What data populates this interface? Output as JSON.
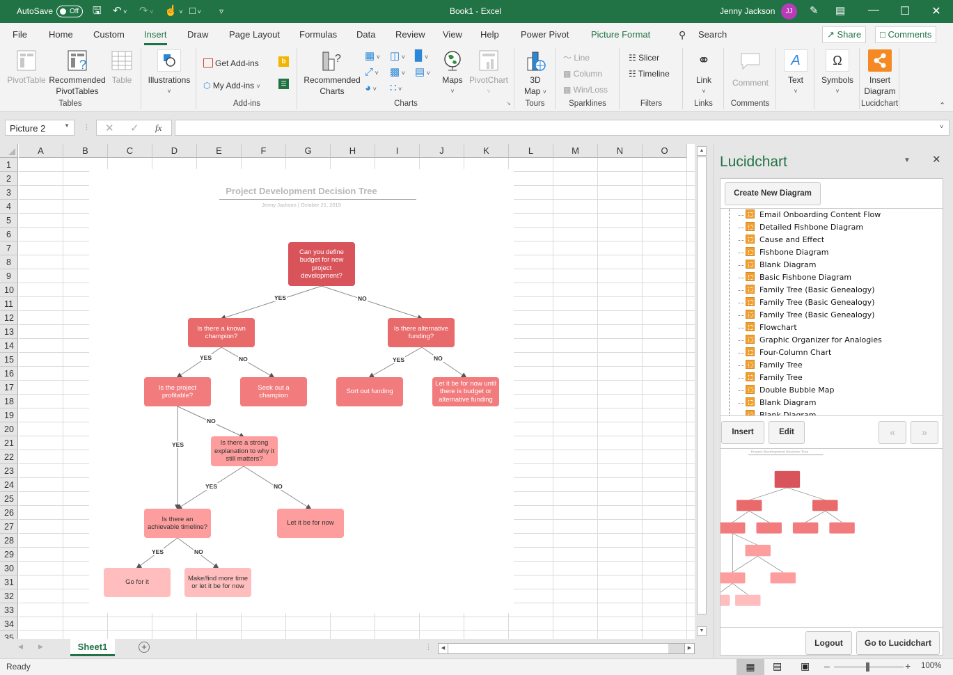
{
  "titlebar": {
    "autosave_label": "AutoSave",
    "autosave_state": "Off",
    "doc_title": "Book1  -  Excel",
    "user_name": "Jenny Jackson",
    "user_initials": "JJ"
  },
  "menu": {
    "tabs": [
      "File",
      "Home",
      "Custom",
      "Insert",
      "Draw",
      "Page Layout",
      "Formulas",
      "Data",
      "Review",
      "View",
      "Help",
      "Power Pivot",
      "Picture Format"
    ],
    "active_tab": "Insert",
    "search_label": "Search",
    "share_label": "Share",
    "comments_label": "Comments"
  },
  "ribbon": {
    "tables": {
      "label": "Tables",
      "pivottable": "PivotTable",
      "recommended_pivot": "Recommended\nPivotTables",
      "rec_l1": "Recommended",
      "rec_l2": "PivotTables",
      "table": "Table"
    },
    "illustrations": {
      "label": "Illustrations"
    },
    "addins": {
      "label": "Add-ins",
      "get": "Get Add-ins",
      "my": "My Add-ins"
    },
    "charts": {
      "label": "Charts",
      "rec_l1": "Recommended",
      "rec_l2": "Charts",
      "maps": "Maps",
      "pivotchart": "PivotChart"
    },
    "tours": {
      "label": "Tours",
      "map_l1": "3D",
      "map_l2": "Map"
    },
    "sparklines": {
      "label": "Sparklines",
      "line": "Line",
      "column": "Column",
      "winloss": "Win/Loss"
    },
    "filters": {
      "label": "Filters",
      "slicer": "Slicer",
      "timeline": "Timeline"
    },
    "links": {
      "label": "Links",
      "link": "Link"
    },
    "comments": {
      "label": "Comments",
      "comment": "Comment"
    },
    "text": {
      "text": "Text"
    },
    "symbols": {
      "symbols": "Symbols"
    },
    "lucidchart": {
      "label": "Lucidchart",
      "insert_l1": "Insert",
      "insert_l2": "Diagram"
    }
  },
  "formula_bar": {
    "name_box": "Picture 2",
    "fx_label": "fx",
    "formula": ""
  },
  "grid": {
    "columns": [
      "A",
      "B",
      "C",
      "D",
      "E",
      "F",
      "G",
      "H",
      "I",
      "J",
      "K",
      "L",
      "M",
      "N",
      "O"
    ],
    "rows": [
      "1",
      "2",
      "3",
      "4",
      "5",
      "6",
      "7",
      "8",
      "9",
      "10",
      "11",
      "12",
      "13",
      "14",
      "15",
      "16",
      "17",
      "18",
      "19",
      "20",
      "21",
      "22",
      "23",
      "24",
      "25",
      "26",
      "27",
      "28",
      "29",
      "30",
      "31",
      "32",
      "33",
      "34",
      "35"
    ]
  },
  "diagram": {
    "title": "Project Development Decision Tree",
    "subtitle": "Jenny Jackson  |  October 21, 2019",
    "nodes": {
      "root": "Can you define budget for new project development?",
      "champion": "Is there a known champion?",
      "altfunding": "Is there alternative funding?",
      "profitable": "Is the project profitable?",
      "seek": "Seek out a champion",
      "sortfunding": "Sort out funding",
      "letbeuntil": "Let it be for now until there is budget or alternative funding",
      "explanation": "Is there a strong explanation to why it still matters?",
      "timeline": "Is there an achievable timeline?",
      "letbe": "Let it be for now",
      "gofor": "Go for it",
      "maketime": "Make/find more time or let it be for now"
    },
    "edge_labels": {
      "yes": "YES",
      "no": "NO"
    },
    "colors": {
      "level1": "#d9545a",
      "level2": "#e96a6b",
      "level3": "#f27c7d",
      "level4": "#fd9d9d",
      "level5": "#ffbdbd"
    }
  },
  "sheets": {
    "tabs": [
      "Sheet1"
    ],
    "active": "Sheet1"
  },
  "status": {
    "ready": "Ready",
    "zoom": "100%"
  },
  "lucidchart_pane": {
    "title": "Lucidchart",
    "create_button": "Create New Diagram",
    "documents": [
      "Email Onboarding Content Flow",
      "Detailed Fishbone Diagram",
      "Cause and Effect",
      "Fishbone Diagram",
      "Blank Diagram",
      "Basic Fishbone Diagram",
      "Family Tree (Basic Genealogy)",
      "Family Tree (Basic Genealogy)",
      "Family Tree (Basic Genealogy)",
      "Flowchart",
      "Graphic Organizer for Analogies",
      "Four-Column Chart",
      "Family Tree",
      "Family Tree",
      "Double Bubble Map",
      "Blank Diagram",
      "Blank Diagram"
    ],
    "insert_button": "Insert",
    "edit_button": "Edit",
    "prev_button": "«",
    "next_button": "»",
    "logout_button": "Logout",
    "goto_button": "Go to Lucidchart"
  }
}
